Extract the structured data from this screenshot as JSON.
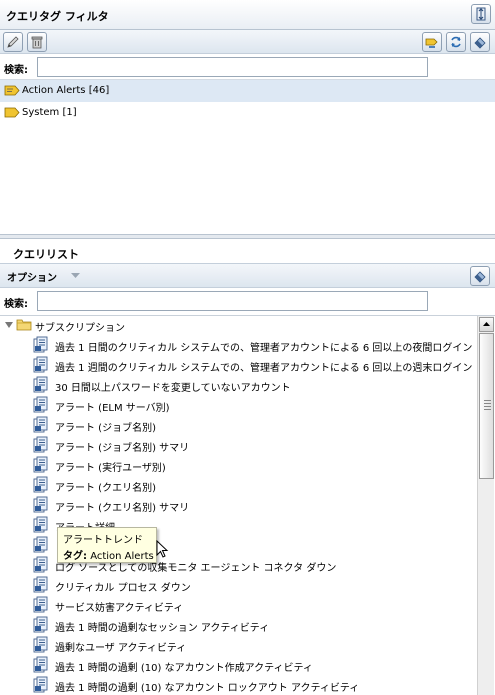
{
  "query_tag_filter": {
    "title": "クエリタグ フィルタ",
    "search_label": "検索:",
    "search_value": "",
    "tags": [
      {
        "label": "Action Alerts [46]"
      },
      {
        "label": "System [1]"
      }
    ]
  },
  "query_list": {
    "title": "クエリリスト",
    "options_label": "オプション",
    "search_label": "検索:",
    "search_value": "",
    "folder_label": "サブスクリプション",
    "items": [
      "過去 1 日間のクリティカル システムでの、管理者アカウントによる 6 回以上の夜間ログイン",
      "過去 1 週間のクリティカル システムでの、管理者アカウントによる 6 回以上の週末ログイン",
      "30 日間以上パスワードを変更していないアカウント",
      "アラート (ELM サーバ別)",
      "アラート (ジョブ名別)",
      "アラート (ジョブ名別) サマリ",
      "アラート (実行ユーザ別)",
      "アラート (クエリ名別)",
      "アラート (クエリ名別) サマリ",
      "アラート詳細",
      "",
      "ログ ソースとしての収集モニタ エージェント コネクタ ダウン",
      "クリティカル プロセス ダウン",
      "サービス妨害アクティビティ",
      "過去 1 時間の過剰なセッション アクティビティ",
      "過剰なユーザ アクティビティ",
      "過去 1 時間の過剰 (10) なアカウント作成アクティビティ",
      "過去 1 時間の過剰 (10) なアカウント ロックアウト アクティビティ"
    ]
  },
  "tooltip": {
    "title": "アラートトレンド",
    "tag_label": "タグ:",
    "tag_value": "Action Alerts"
  }
}
